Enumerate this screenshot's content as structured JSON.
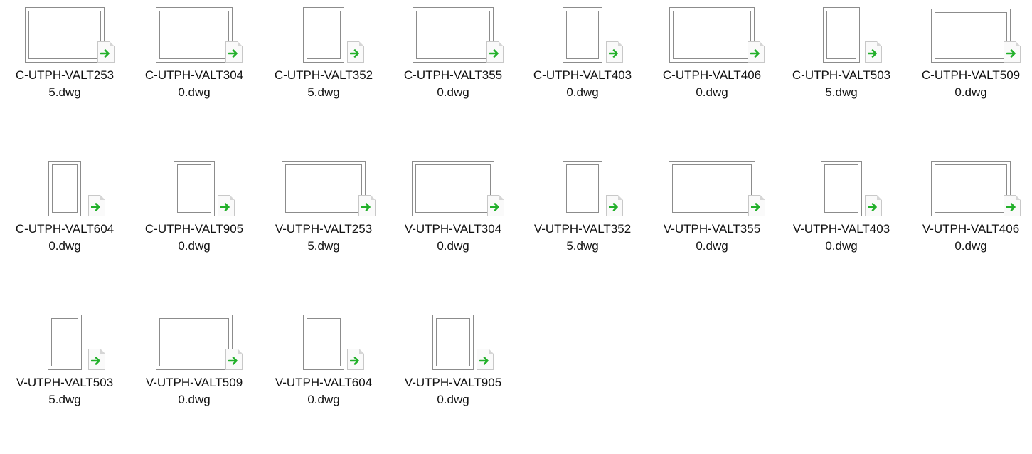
{
  "files": [
    {
      "name_line1": "C-UTPH-VALT253",
      "name_line2": "5.dwg",
      "orientation": "landscape"
    },
    {
      "name_line1": "C-UTPH-VALT304",
      "name_line2": "0.dwg",
      "orientation": "landscape"
    },
    {
      "name_line1": "C-UTPH-VALT352",
      "name_line2": "5.dwg",
      "orientation": "portrait"
    },
    {
      "name_line1": "C-UTPH-VALT355",
      "name_line2": "0.dwg",
      "orientation": "landscape"
    },
    {
      "name_line1": "C-UTPH-VALT403",
      "name_line2": "0.dwg",
      "orientation": "portrait"
    },
    {
      "name_line1": "C-UTPH-VALT406",
      "name_line2": "0.dwg",
      "orientation": "landscape"
    },
    {
      "name_line1": "C-UTPH-VALT503",
      "name_line2": "5.dwg",
      "orientation": "portrait"
    },
    {
      "name_line1": "C-UTPH-VALT509",
      "name_line2": "0.dwg",
      "orientation": "landscape"
    },
    {
      "name_line1": "C-UTPH-VALT604",
      "name_line2": "0.dwg",
      "orientation": "portrait"
    },
    {
      "name_line1": "C-UTPH-VALT905",
      "name_line2": "0.dwg",
      "orientation": "portrait"
    },
    {
      "name_line1": "V-UTPH-VALT253",
      "name_line2": "5.dwg",
      "orientation": "landscape"
    },
    {
      "name_line1": "V-UTPH-VALT304",
      "name_line2": "0.dwg",
      "orientation": "landscape"
    },
    {
      "name_line1": "V-UTPH-VALT352",
      "name_line2": "5.dwg",
      "orientation": "portrait"
    },
    {
      "name_line1": "V-UTPH-VALT355",
      "name_line2": "0.dwg",
      "orientation": "landscape"
    },
    {
      "name_line1": "V-UTPH-VALT403",
      "name_line2": "0.dwg",
      "orientation": "portrait"
    },
    {
      "name_line1": "V-UTPH-VALT406",
      "name_line2": "0.dwg",
      "orientation": "landscape"
    },
    {
      "name_line1": "V-UTPH-VALT503",
      "name_line2": "5.dwg",
      "orientation": "portrait"
    },
    {
      "name_line1": "V-UTPH-VALT509",
      "name_line2": "0.dwg",
      "orientation": "landscape"
    },
    {
      "name_line1": "V-UTPH-VALT604",
      "name_line2": "0.dwg",
      "orientation": "portrait"
    },
    {
      "name_line1": "V-UTPH-VALT905",
      "name_line2": "0.dwg",
      "orientation": "portrait"
    }
  ],
  "badge_icon": "shortcut-arrow-icon",
  "colors": {
    "arrow": "#22b02a",
    "thumb_border": "#8c8c8c",
    "label_text": "#111111",
    "background": "#ffffff"
  }
}
